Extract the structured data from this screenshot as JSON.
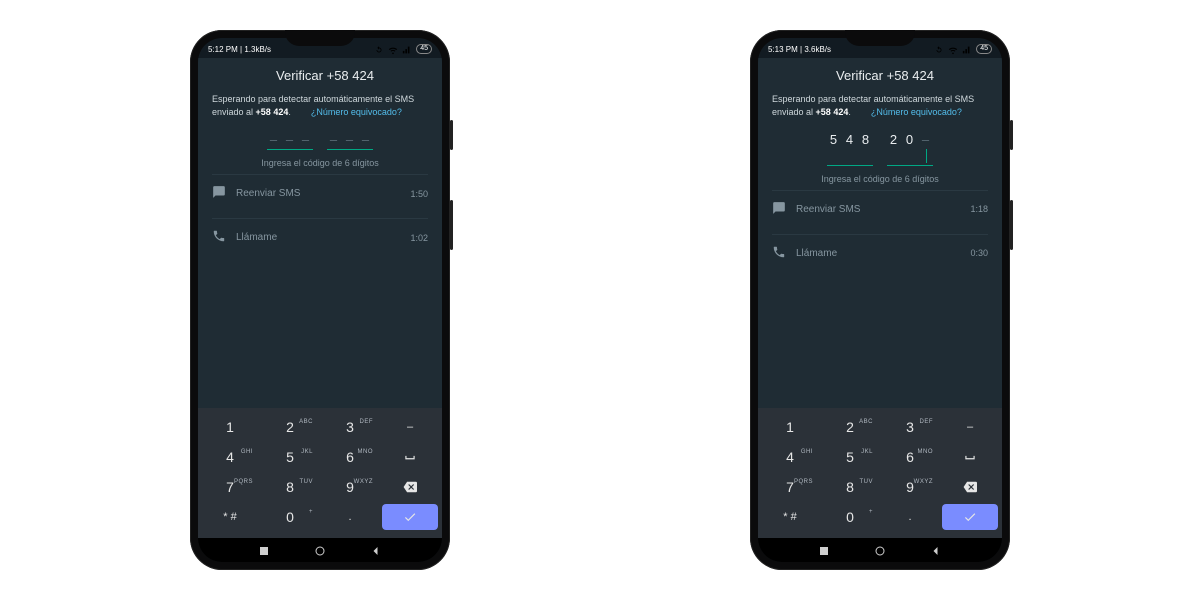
{
  "phones": [
    {
      "status": {
        "time": "5:12 PM",
        "net": "1.3kB/s",
        "battery": "45"
      },
      "title": "Verificar +58 424",
      "wait_pre": "Esperando para detectar automáticamente el SMS enviado al ",
      "wait_bold": "+58 424",
      "wrong": "¿Número equivocado?",
      "code": [
        "",
        "",
        "",
        "",
        "",
        ""
      ],
      "hint": "Ingresa el código de 6 dígitos",
      "resend_label": "Reenviar SMS",
      "resend_timer": "1:50",
      "call_label": "Llámame",
      "call_timer": "1:02"
    },
    {
      "status": {
        "time": "5:13 PM",
        "net": "3.6kB/s",
        "battery": "45"
      },
      "title": "Verificar +58 424",
      "wait_pre": "Esperando para detectar automáticamente el SMS enviado al ",
      "wait_bold": "+58 424",
      "wrong": "¿Número equivocado?",
      "code": [
        "5",
        "4",
        "8",
        "2",
        "0",
        ""
      ],
      "hint": "Ingresa el código de 6 dígitos",
      "resend_label": "Reenviar SMS",
      "resend_timer": "1:18",
      "call_label": "Llámame",
      "call_timer": "0:30"
    }
  ],
  "keypad": {
    "rows": [
      [
        {
          "n": "1",
          "s": ""
        },
        {
          "n": "2",
          "s": "ABC"
        },
        {
          "n": "3",
          "s": "DEF"
        },
        {
          "n": "–",
          "s": "",
          "sym": true
        }
      ],
      [
        {
          "n": "4",
          "s": "GHI"
        },
        {
          "n": "5",
          "s": "JKL"
        },
        {
          "n": "6",
          "s": "MNO"
        },
        {
          "n": "␣",
          "s": "",
          "sym": true,
          "space": true
        }
      ],
      [
        {
          "n": "7",
          "s": "PQRS"
        },
        {
          "n": "8",
          "s": "TUV"
        },
        {
          "n": "9",
          "s": "WXYZ"
        },
        {
          "n": "⌫",
          "s": "",
          "sym": true,
          "bksp": true
        }
      ],
      [
        {
          "n": "* #",
          "s": "",
          "sym": true
        },
        {
          "n": "0",
          "s": "+"
        },
        {
          "n": ".",
          "s": "",
          "sym": true
        },
        {
          "n": "✓",
          "s": "",
          "enter": true
        }
      ]
    ]
  }
}
